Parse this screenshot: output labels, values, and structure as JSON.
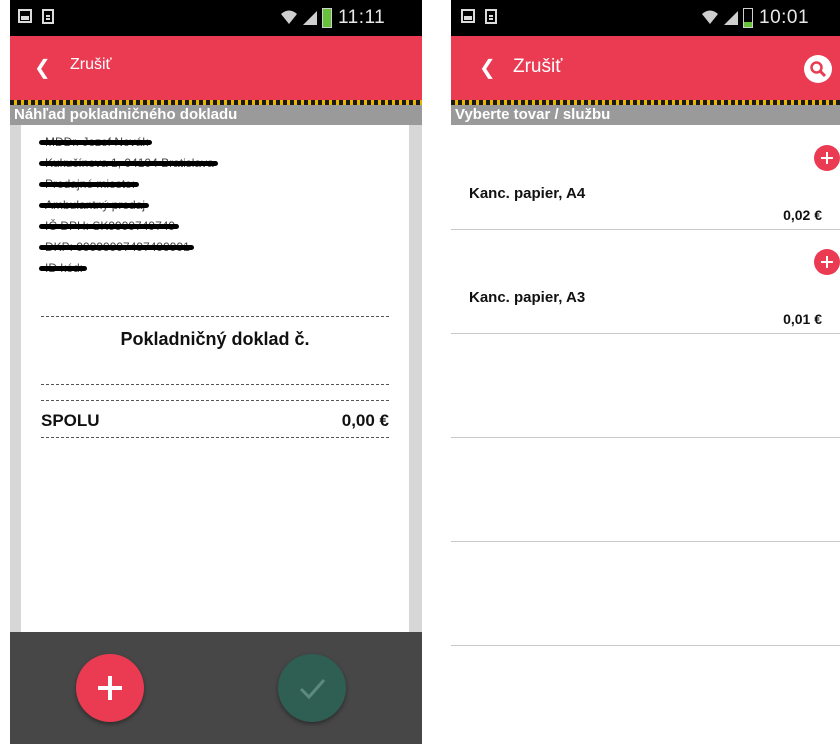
{
  "left": {
    "status": {
      "time": "11:11"
    },
    "appbar": {
      "cancel": "Zrušiť"
    },
    "section_title": "Náhľad pokladničného dokladu",
    "receipt": {
      "header_lines": [
        "MDDr. Jozef Novák",
        "Kukučínova 1, 04104 Bratislava",
        "Predajné miesto:",
        "Ambulantný predaj",
        "IČ DPH: SK9999749749",
        "DKP: 99999997497499991",
        "ID kód:"
      ],
      "title": "Pokladničný doklad č.",
      "total_label": "SPOLU",
      "total_value": "0,00 €"
    }
  },
  "right": {
    "status": {
      "time": "10:01"
    },
    "appbar": {
      "cancel": "Zrušiť"
    },
    "section_title": "Vyberte tovar / službu",
    "items": [
      {
        "name": "Kanc. papier, A4",
        "price": "0,02 €"
      },
      {
        "name": "Kanc. papier, A3",
        "price": "0,01 €"
      },
      {
        "name": "",
        "price": ""
      },
      {
        "name": "",
        "price": ""
      },
      {
        "name": "",
        "price": ""
      },
      {
        "name": "",
        "price": ""
      }
    ]
  },
  "colors": {
    "accent_red": "#ea3b53",
    "confirm_green": "#2f5e52",
    "header_gray": "#9a9a9a",
    "battery_green": "#67c23a"
  },
  "icons": [
    "image-icon",
    "document-icon",
    "wifi-icon",
    "signal-icon",
    "battery-icon",
    "chevron-left-icon",
    "search-icon",
    "plus-icon",
    "check-icon"
  ]
}
